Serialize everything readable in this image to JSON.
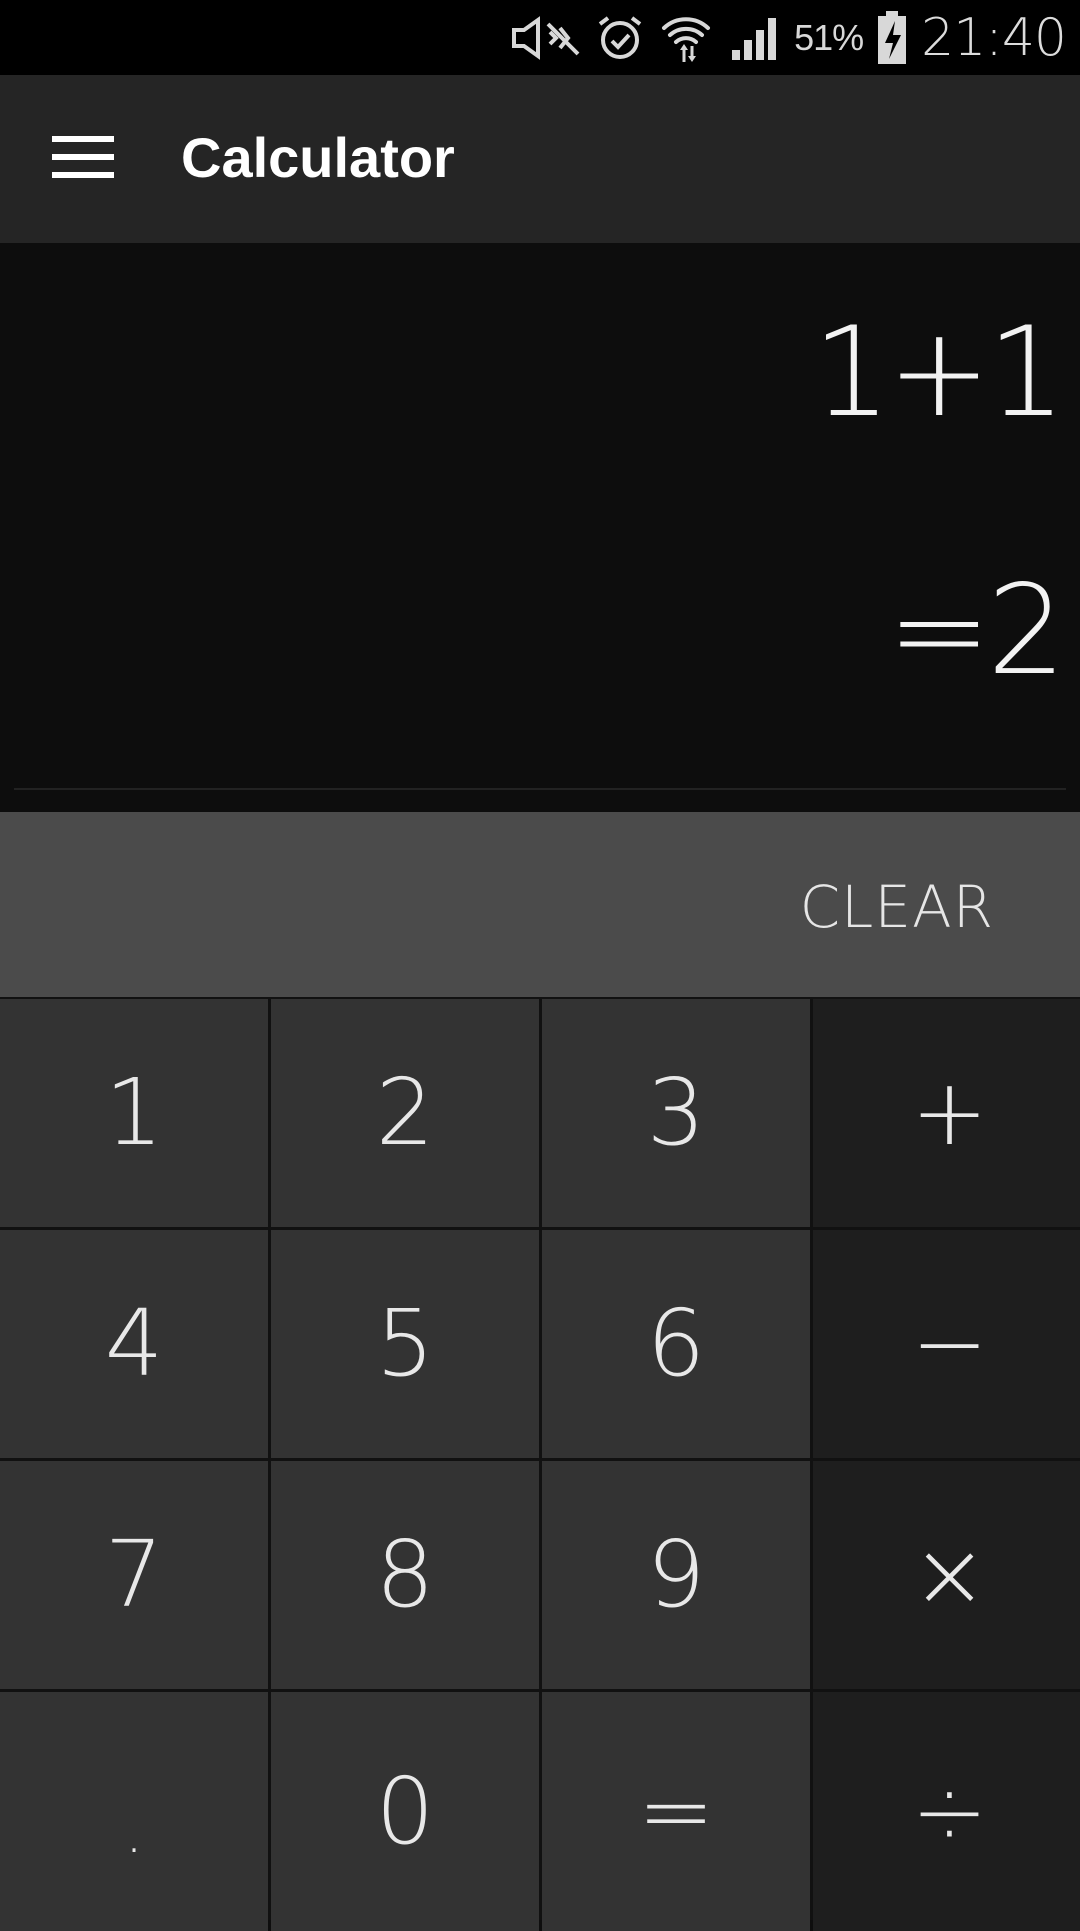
{
  "status_bar": {
    "battery_percent": "51%",
    "time": "21:40",
    "icons": [
      "mute-icon",
      "alarm-icon",
      "wifi-icon",
      "signal-icon",
      "battery-charging-icon"
    ]
  },
  "app_bar": {
    "menu_icon": "menu-icon",
    "title": "Calculator"
  },
  "display": {
    "expression": "1+1",
    "result": "=2"
  },
  "clear_label": "CLEAR",
  "keypad": {
    "keys": [
      {
        "label": "1",
        "type": "digit"
      },
      {
        "label": "2",
        "type": "digit"
      },
      {
        "label": "3",
        "type": "digit"
      },
      {
        "label": "+",
        "type": "operator"
      },
      {
        "label": "4",
        "type": "digit"
      },
      {
        "label": "5",
        "type": "digit"
      },
      {
        "label": "6",
        "type": "digit"
      },
      {
        "label": "−",
        "type": "operator"
      },
      {
        "label": "7",
        "type": "digit"
      },
      {
        "label": "8",
        "type": "digit"
      },
      {
        "label": "9",
        "type": "digit"
      },
      {
        "label": "×",
        "type": "operator"
      },
      {
        "label": ".",
        "type": "digit"
      },
      {
        "label": "0",
        "type": "digit"
      },
      {
        "label": "=",
        "type": "digit"
      },
      {
        "label": "÷",
        "type": "operator"
      }
    ]
  },
  "colors": {
    "status_bar_bg": "#000000",
    "app_bar_bg": "#252525",
    "display_bg": "#0d0d0d",
    "clear_bar_bg": "#4b4b4b",
    "digit_key_bg": "#333333",
    "operator_key_bg": "#1e1e1e",
    "text": "#ffffff"
  }
}
